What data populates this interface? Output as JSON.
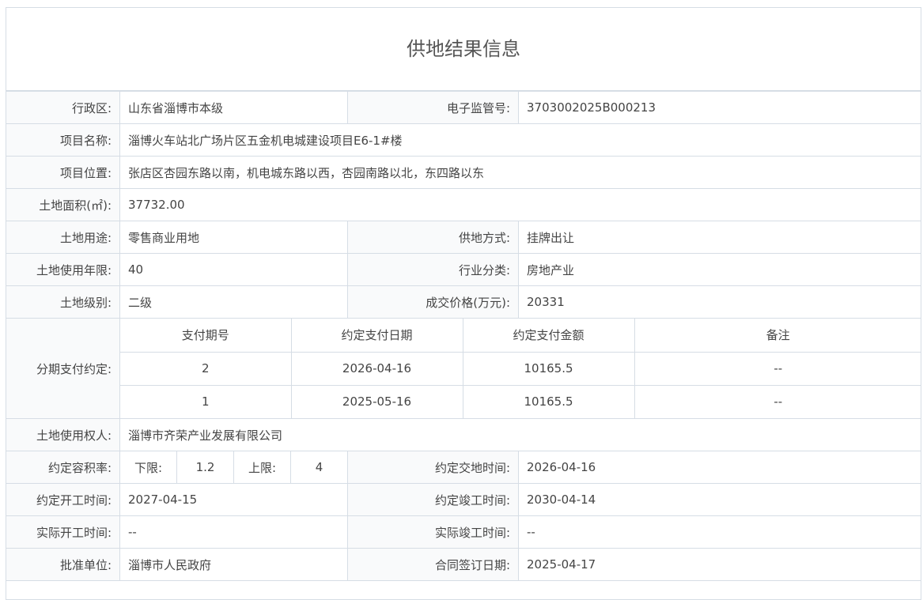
{
  "title": "供地结果信息",
  "region": {
    "label": "行政区:",
    "value": "山东省淄博市本级"
  },
  "supervision_no": {
    "label": "电子监管号:",
    "value": "3703002025B000213"
  },
  "project_name": {
    "label": "项目名称:",
    "value": "淄博火车站北广场片区五金机电城建设项目E6-1#楼"
  },
  "project_location": {
    "label": "项目位置:",
    "value": "张店区杏园东路以南，机电城东路以西，杏园南路以北，东四路以东"
  },
  "land_area": {
    "label": "土地面积(㎡):",
    "value": "37732.00"
  },
  "land_use": {
    "label": "土地用途:",
    "value": "零售商业用地"
  },
  "supply_method": {
    "label": "供地方式:",
    "value": "挂牌出让"
  },
  "use_years": {
    "label": "土地使用年限:",
    "value": "40"
  },
  "industry": {
    "label": "行业分类:",
    "value": "房地产业"
  },
  "land_grade": {
    "label": "土地级别:",
    "value": "二级"
  },
  "deal_price": {
    "label": "成交价格(万元):",
    "value": "20331"
  },
  "installments": {
    "label": "分期支付约定:",
    "headers": [
      "支付期号",
      "约定支付日期",
      "约定支付金额",
      "备注"
    ],
    "rows": [
      [
        "2",
        "2026-04-16",
        "10165.5",
        "--"
      ],
      [
        "1",
        "2025-05-16",
        "10165.5",
        "--"
      ]
    ]
  },
  "land_owner": {
    "label": "土地使用权人:",
    "value": "淄博市齐荣产业发展有限公司"
  },
  "plot_ratio": {
    "label": "约定容积率:",
    "lower_label": "下限:",
    "lower": "1.2",
    "upper_label": "上限:",
    "upper": "4"
  },
  "handover_time": {
    "label": "约定交地时间:",
    "value": "2026-04-16"
  },
  "start_time": {
    "label": "约定开工时间:",
    "value": "2027-04-15"
  },
  "finish_time": {
    "label": "约定竣工时间:",
    "value": "2030-04-14"
  },
  "actual_start": {
    "label": "实际开工时间:",
    "value": "--"
  },
  "actual_finish": {
    "label": "实际竣工时间:",
    "value": "--"
  },
  "approver": {
    "label": "批准单位:",
    "value": "淄博市人民政府"
  },
  "contract_date": {
    "label": "合同签订日期:",
    "value": "2025-04-17"
  }
}
